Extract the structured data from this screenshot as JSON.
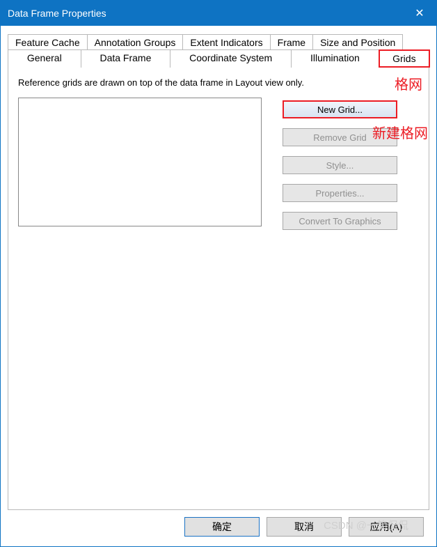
{
  "window": {
    "title": "Data Frame Properties"
  },
  "tabs": {
    "row1": [
      {
        "label": "Feature Cache"
      },
      {
        "label": "Annotation Groups"
      },
      {
        "label": "Extent Indicators"
      },
      {
        "label": "Frame"
      },
      {
        "label": "Size and Position"
      }
    ],
    "row2": [
      {
        "label": "General"
      },
      {
        "label": "Data Frame"
      },
      {
        "label": "Coordinate System"
      },
      {
        "label": "Illumination"
      },
      {
        "label": "Grids",
        "active": true
      }
    ]
  },
  "panel": {
    "description": "Reference grids are drawn on top of the data frame in Layout view only.",
    "buttons": {
      "new_grid": "New Grid...",
      "remove_grid": "Remove Grid",
      "style": "Style...",
      "properties": "Properties...",
      "convert": "Convert To Graphics"
    }
  },
  "annotations": {
    "grids_label": "格网",
    "new_grid_label": "新建格网"
  },
  "footer": {
    "ok": "确定",
    "cancel": "取消",
    "apply": "应用(A)"
  },
  "watermark": "CSDN @一笑侃侃"
}
